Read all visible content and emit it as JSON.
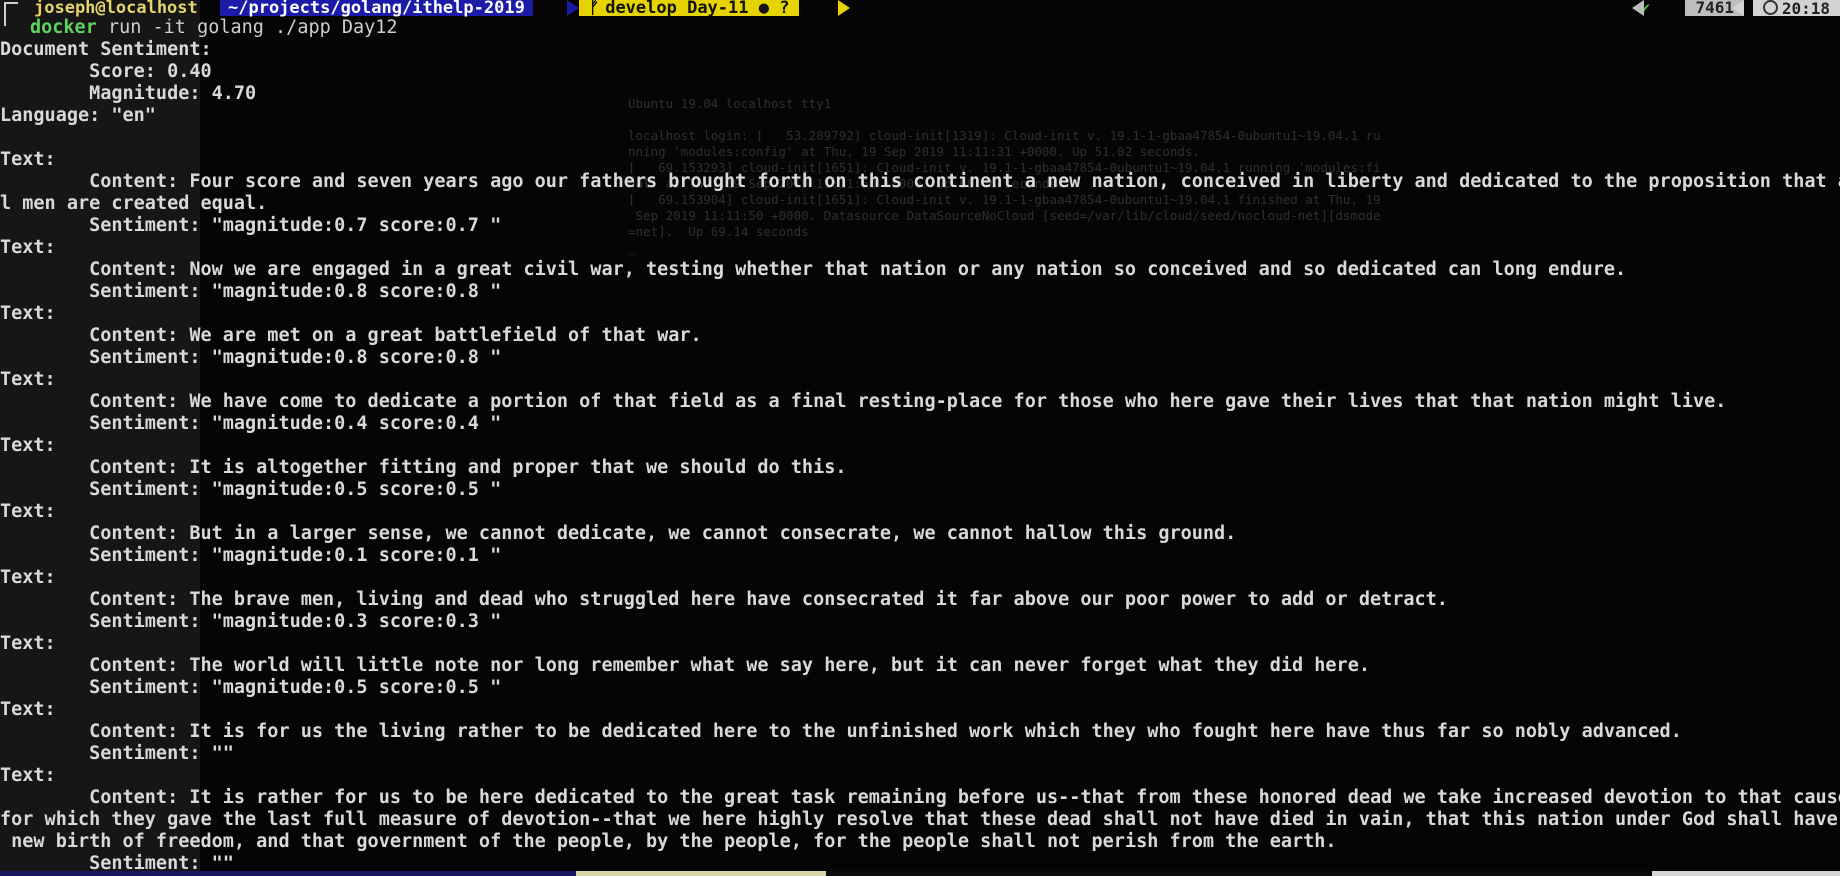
{
  "prompt": {
    "user_host": "joseph@localhost",
    "path": "~/projects/golang/ithelp-2019",
    "git": "develop Day-11 ● ?",
    "check": "✔",
    "history_count": "7461",
    "time": "20:18"
  },
  "command": {
    "program": "docker",
    "args": "run -it golang ./app Day12"
  },
  "document": {
    "header": "Document Sentiment:",
    "score": "        Score: 0.40",
    "magnitude": "        Magnitude: 4.70",
    "language": "Language: \"en\""
  },
  "blocks": [
    {
      "text_label": "Text:",
      "content": [
        "        Content: Four score and seven years ago our fathers brought forth on this continent a new nation, conceived in liberty and dedicated to the proposition that al",
        "l men are created equal."
      ],
      "sentiment": "        Sentiment: \"magnitude:0.7 score:0.7 \""
    },
    {
      "text_label": "Text:",
      "content": [
        "        Content: Now we are engaged in a great civil war, testing whether that nation or any nation so conceived and so dedicated can long endure."
      ],
      "sentiment": "        Sentiment: \"magnitude:0.8 score:0.8 \""
    },
    {
      "text_label": "Text:",
      "content": [
        "        Content: We are met on a great battlefield of that war."
      ],
      "sentiment": "        Sentiment: \"magnitude:0.8 score:0.8 \""
    },
    {
      "text_label": "Text:",
      "content": [
        "        Content: We have come to dedicate a portion of that field as a final resting-place for those who here gave their lives that that nation might live."
      ],
      "sentiment": "        Sentiment: \"magnitude:0.4 score:0.4 \""
    },
    {
      "text_label": "Text:",
      "content": [
        "        Content: It is altogether fitting and proper that we should do this."
      ],
      "sentiment": "        Sentiment: \"magnitude:0.5 score:0.5 \""
    },
    {
      "text_label": "Text:",
      "content": [
        "        Content: But in a larger sense, we cannot dedicate, we cannot consecrate, we cannot hallow this ground."
      ],
      "sentiment": "        Sentiment: \"magnitude:0.1 score:0.1 \""
    },
    {
      "text_label": "Text:",
      "content": [
        "        Content: The brave men, living and dead who struggled here have consecrated it far above our poor power to add or detract."
      ],
      "sentiment": "        Sentiment: \"magnitude:0.3 score:0.3 \""
    },
    {
      "text_label": "Text:",
      "content": [
        "        Content: The world will little note nor long remember what we say here, but it can never forget what they did here."
      ],
      "sentiment": "        Sentiment: \"magnitude:0.5 score:0.5 \""
    },
    {
      "text_label": "Text:",
      "content": [
        "        Content: It is for us the living rather to be dedicated here to the unfinished work which they who fought here have thus far so nobly advanced."
      ],
      "sentiment": "        Sentiment: \"\""
    },
    {
      "text_label": "Text:",
      "content": [
        "        Content: It is rather for us to be here dedicated to the great task remaining before us--that from these honored dead we take increased devotion to that cause",
        "for which they gave the last full measure of devotion--that we here highly resolve that these dead shall not have died in vain, that this nation under God shall have a",
        " new birth of freedom, and that government of the people, by the people, for the people shall not perish from the earth."
      ],
      "sentiment": "        Sentiment: \"\""
    }
  ],
  "background_console": [
    "Ubuntu 19.04 localhost tty1",
    "",
    "localhost login: [   53.289792] cloud-init[1319]: Cloud-init v. 19.1-1-gbaa47854-0ubuntu1~19.04.1 ru",
    "nning 'modules:config' at Thu, 19 Sep 2019 11:11:31 +0000. Up 51.02 seconds.",
    "[   69.153293] cloud-init[1651]: Cloud-init v. 19.1-1-gbaa47854-0ubuntu1~19.04.1 running 'modules:fi",
    "nal' at Thu, 19 Sep 2019 11:11:50 +0000. Up 68.46 seconds.",
    "[   69.153904] cloud-init[1651]: Cloud-init v. 19.1-1-gbaa47854-0ubuntu1~19.04.1 finished at Thu, 19",
    " Sep 2019 11:11:50 +0000. Datasource DataSourceNoCloud [seed=/var/lib/cloud/seed/nocloud-net][dsmode",
    "=net].  Up 69.14 seconds",
    "_"
  ]
}
